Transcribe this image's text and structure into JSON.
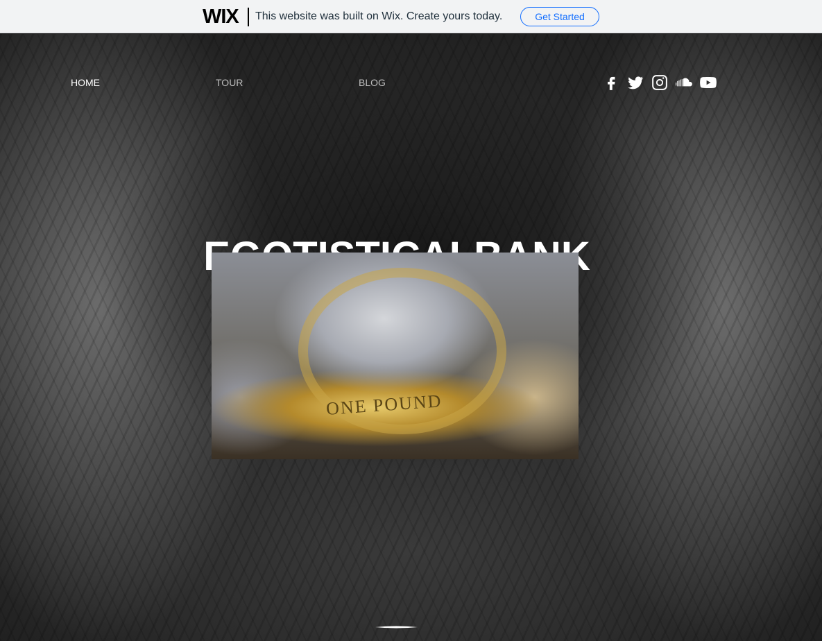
{
  "wix_banner": {
    "logo": "WIX",
    "message": "This website was built on Wix. Create yours today.",
    "cta": "Get Started"
  },
  "nav": {
    "items": [
      {
        "label": "HOME",
        "active": true
      },
      {
        "label": "TOUR",
        "active": false
      },
      {
        "label": "BLOG",
        "active": false
      }
    ]
  },
  "social": [
    "facebook-icon",
    "twitter-icon",
    "instagram-icon",
    "soundcloud-icon",
    "youtube-icon"
  ],
  "hero": {
    "title": "EGOTISTICALBANK",
    "image_caption_text": "ONE POUND"
  },
  "colors": {
    "cta": "#116dff",
    "banner_bg": "#f2f3f4",
    "text": "#ffffff"
  }
}
